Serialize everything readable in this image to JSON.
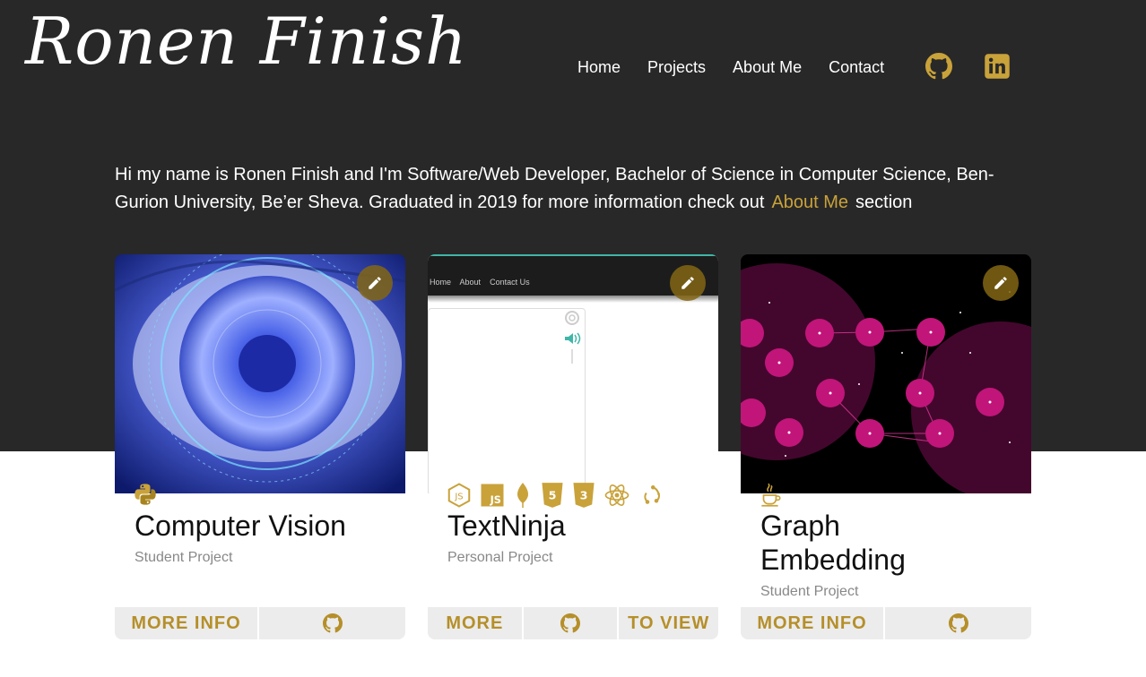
{
  "header": {
    "logo": "Ronen Finish",
    "nav": [
      {
        "label": "Home"
      },
      {
        "label": "Projects"
      },
      {
        "label": "About Me"
      },
      {
        "label": "Contact"
      }
    ]
  },
  "intro": {
    "text_before": "Hi my name is Ronen Finish and I'm Software/Web Developer, Bachelor of Science in Computer Science, Ben-Gurion University, Be’er Sheva. Graduated in 2019 for more information check out",
    "link": "About Me",
    "text_after": "section"
  },
  "cards": [
    {
      "title": "Computer Vision",
      "subtitle": "Student Project",
      "tech_icons": [
        "python-icon"
      ],
      "actions": [
        "MORE INFO"
      ]
    },
    {
      "title": "TextNinja",
      "subtitle": "Personal Project",
      "tech_icons": [
        "nodejs-icon",
        "javascript-icon",
        "mongodb-icon",
        "html5-icon",
        "css3-icon",
        "react-icon",
        "redux-icon"
      ],
      "actions": [
        "MORE",
        "TO VIEW"
      ],
      "screenshot_nav": [
        "Home",
        "About",
        "Contact Us"
      ]
    },
    {
      "title": "Graph Embedding",
      "subtitle": "Student Project",
      "tech_icons": [
        "java-icon"
      ],
      "actions": [
        "MORE INFO"
      ]
    }
  ],
  "colors": {
    "dark_bg": "#282828",
    "accent": "#c9a23a",
    "button_text": "#b58f2a",
    "button_bg": "#ececec"
  }
}
